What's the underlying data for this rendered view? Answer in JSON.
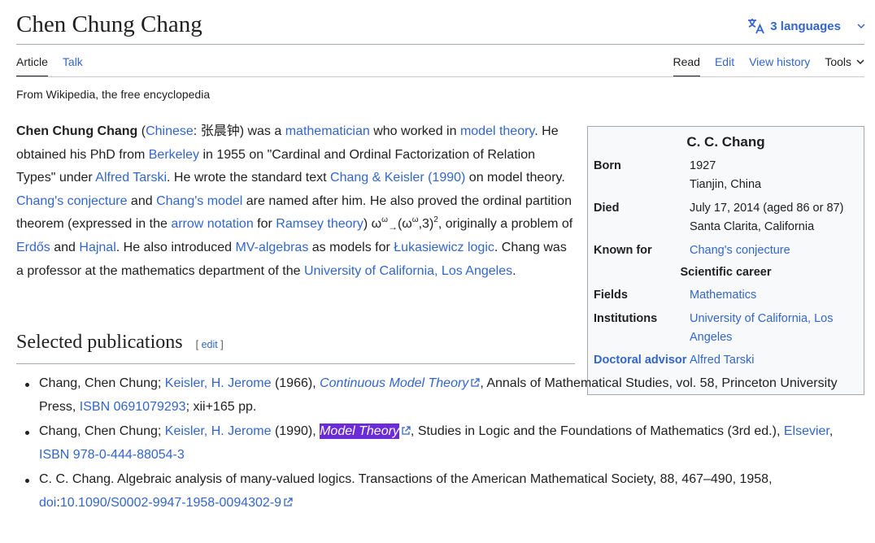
{
  "title": "Chen Chung Chang",
  "languages_label": "3 languages",
  "tabs_left": [
    "Article",
    "Talk"
  ],
  "tabs_right": [
    "Read",
    "Edit",
    "View history"
  ],
  "tools_label": "Tools",
  "tagline": "From Wikipedia, the free encyclopedia",
  "lead": {
    "name": "Chen Chung Chang",
    "t1": " (",
    "l_chinese": "Chinese",
    "t2": ": 张晨钟) was a ",
    "l_mathematician": "mathematician",
    "t3": " who worked in ",
    "l_model_theory": "model theory",
    "t4": ". He obtained his PhD from ",
    "l_berkeley": "Berkeley",
    "t5": " in 1955 on \"Cardinal and Ordinal Factorization of Relation Types\" under ",
    "l_tarski": "Alfred Tarski",
    "t6": ". He wrote the standard text ",
    "l_chang_keisler": "Chang & Keisler (1990)",
    "t7": " on model theory. ",
    "l_conjecture": "Chang's conjecture",
    "t8": " and ",
    "l_model": "Chang's model",
    "t9": " are named after him. He also proved the ordinal partition theorem (expressed in the ",
    "l_arrow": "arrow notation",
    "t10": " for ",
    "l_ramsey": "Ramsey theory",
    "t11": ") ω",
    "sup_omega": "ω",
    "sub_arrow": "→",
    "t12": "(ω",
    "sup_omega2": "ω",
    "t13": ",3)",
    "sup_two": "2",
    "t14": ", originally a problem of ",
    "l_erdos": "Erdős",
    "t15": " and ",
    "l_hajnal": "Hajnal",
    "t16": ". He also introduced ",
    "l_mv": "MV-algebras",
    "t17": " as models for ",
    "l_luk": "Łukasiewicz logic",
    "t18": ". Chang was a professor at the mathematics department of the ",
    "l_ucla": "University of California, Los Angeles",
    "t19": "."
  },
  "infobox": {
    "title": "C. C. Chang",
    "born_label": "Born",
    "born_date": "1927",
    "born_place": "Tianjin, China",
    "died_label": "Died",
    "died_date": "July 17, 2014 (aged 86 or 87)",
    "died_place": "Santa Clarita, California",
    "known_label": "Known for",
    "known_value": "Chang's conjecture",
    "career_header": "Scientific career",
    "fields_label": "Fields",
    "fields_value": "Mathematics",
    "inst_label": "Institutions",
    "inst_value": "University of California, Los Angeles",
    "advisor_label": "Doctoral advisor",
    "advisor_value": "Alfred Tarski"
  },
  "section": {
    "title": "Selected publications",
    "edit_open": "[ ",
    "edit_label": "edit",
    "edit_close": " ]"
  },
  "pubs": [
    {
      "a": "Chang, Chen Chung; ",
      "author_link": "Keisler, H. Jerome",
      "b": " (1966), ",
      "title_link": "Continuous Model Theory",
      "c": ", Annals of Mathematical Studies, vol. 58, Princeton University Press, ",
      "isbn_link": "ISBN 0691079293",
      "d": "; xii+165 pp."
    },
    {
      "a": "Chang, Chen Chung; ",
      "author_link": "Keisler, H. Jerome",
      "b": " (1990), ",
      "title_link": "Model Theory",
      "c": ", Studies in Logic and the Foundations of Mathematics (3rd ed.), ",
      "publisher_link": "Elsevier",
      "sep": ", ",
      "isbn_link": "ISBN 978-0-444-88054-3"
    },
    {
      "a": "C. C. Chang. Algebraic analysis of many-valued logics. Transactions of the American Mathematical Society, 88, 467–490, 1958, ",
      "doi_label": "doi",
      "colon": ":",
      "doi_link": "10.1090/S0002-9947-1958-0094302-9"
    }
  ],
  "colors": {
    "link": "#3366cc",
    "text": "#202122",
    "highlight": "#6b2bd9",
    "rule": "#a2a9b1",
    "infobox_bg": "#f8f9fa"
  }
}
